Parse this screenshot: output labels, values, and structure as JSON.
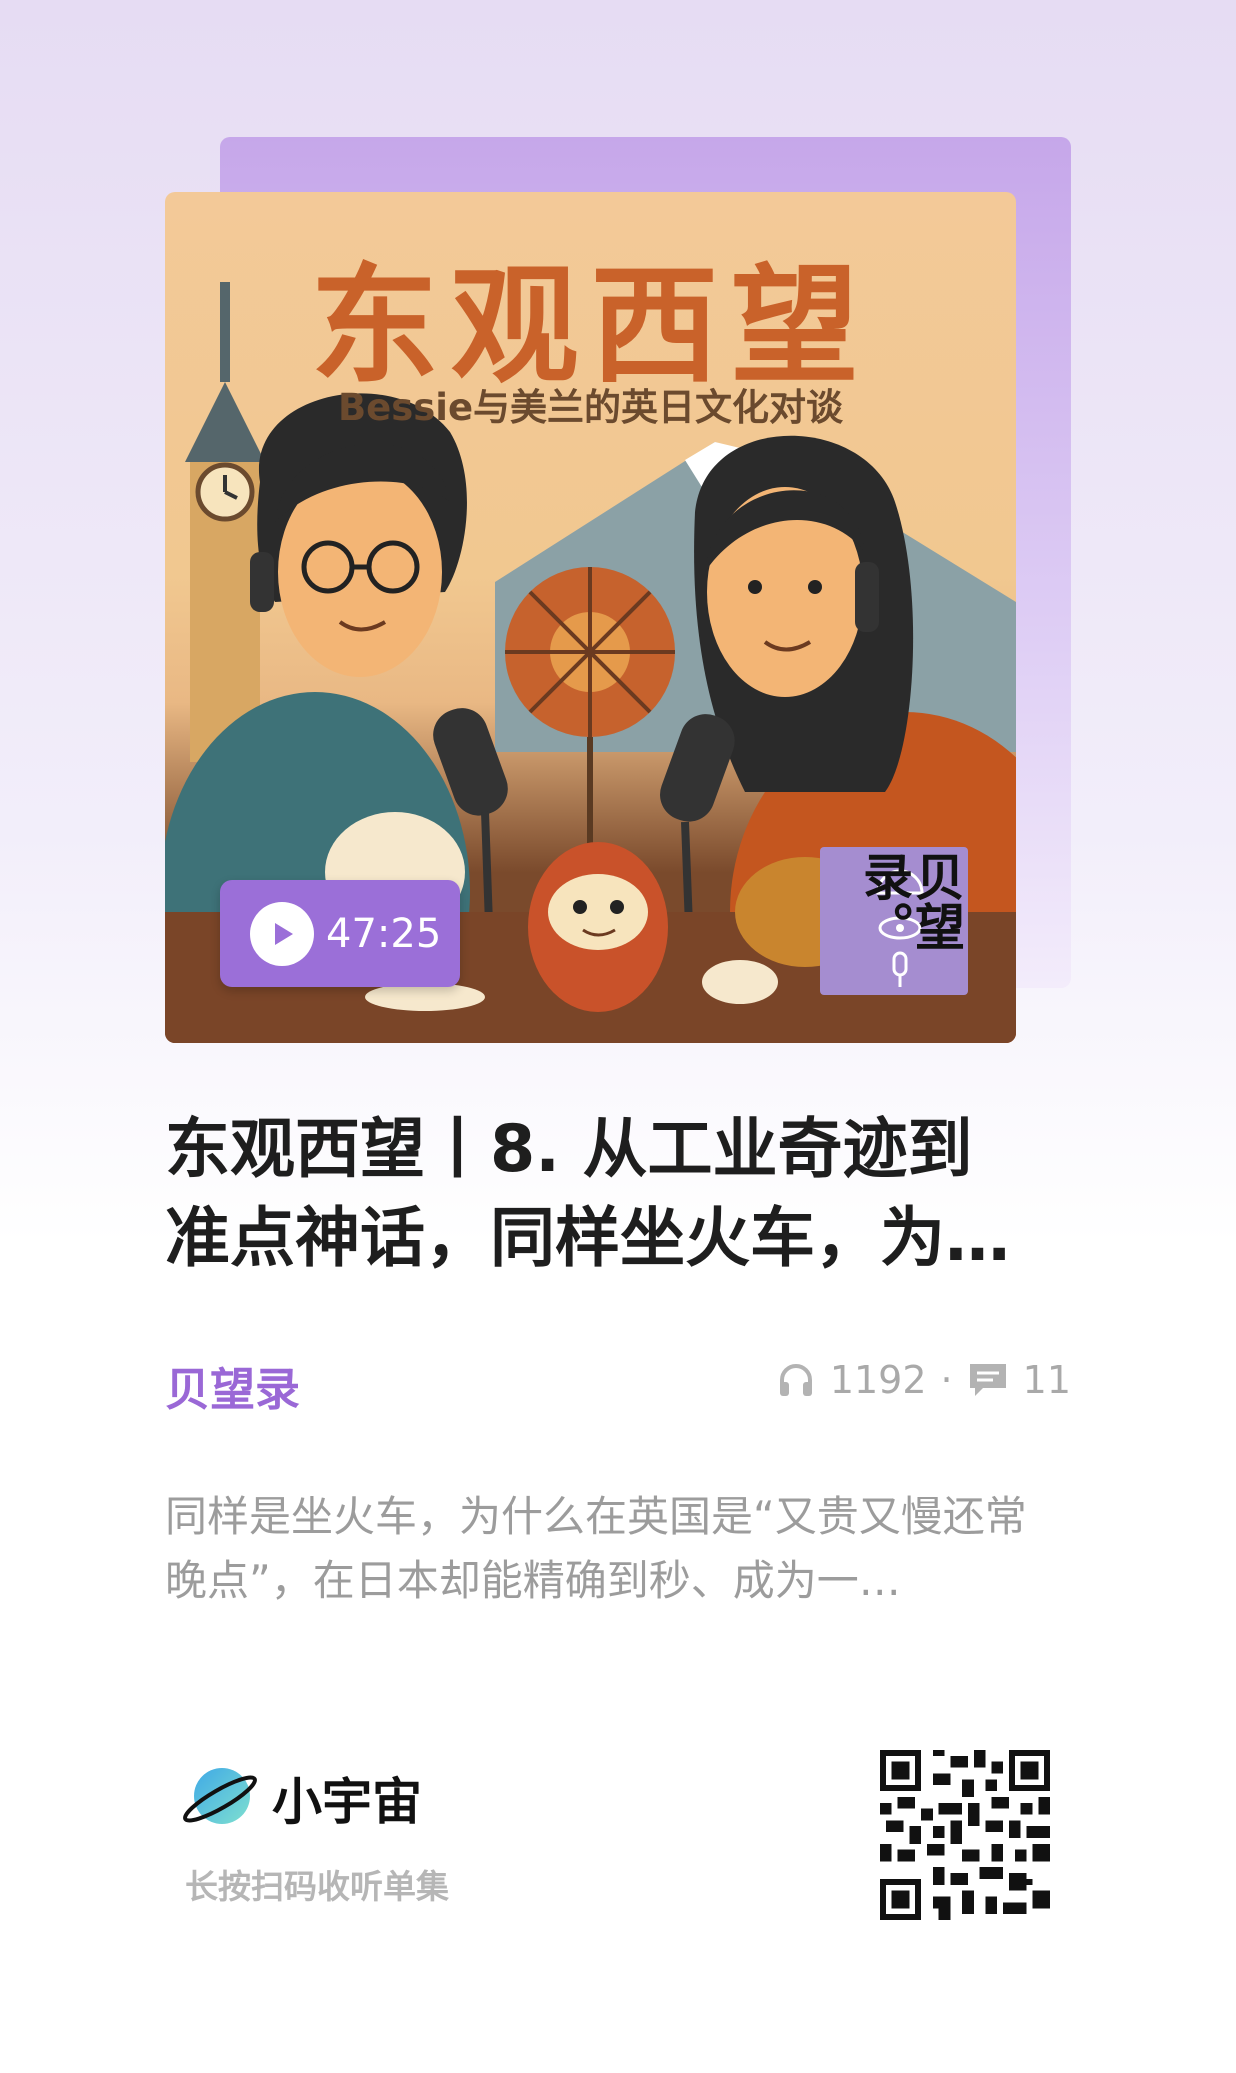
{
  "cover": {
    "title": "东观西望",
    "subtitle": "Bessie与美兰的英日文化对谈",
    "duration": "47:25",
    "badge_text": "贝望录。"
  },
  "episode": {
    "title": "东观西望丨8. 从工业奇迹到准点神话，同样坐火车，为…",
    "podcast_name": "贝望录",
    "listen_count": "1192",
    "separator": "·",
    "comment_count": "11",
    "description": "同样是坐火车，为什么在英国是“又贵又慢还常晚点”，在日本却能精确到秒、成为一…"
  },
  "footer": {
    "brand_name": "小宇宙",
    "scan_hint": "长按扫码收听单集"
  },
  "colors": {
    "accent": "#9b6fd8",
    "title_orange": "#c9622a",
    "text_dark": "#1e1e1e",
    "text_gray": "#9c9c9c"
  }
}
